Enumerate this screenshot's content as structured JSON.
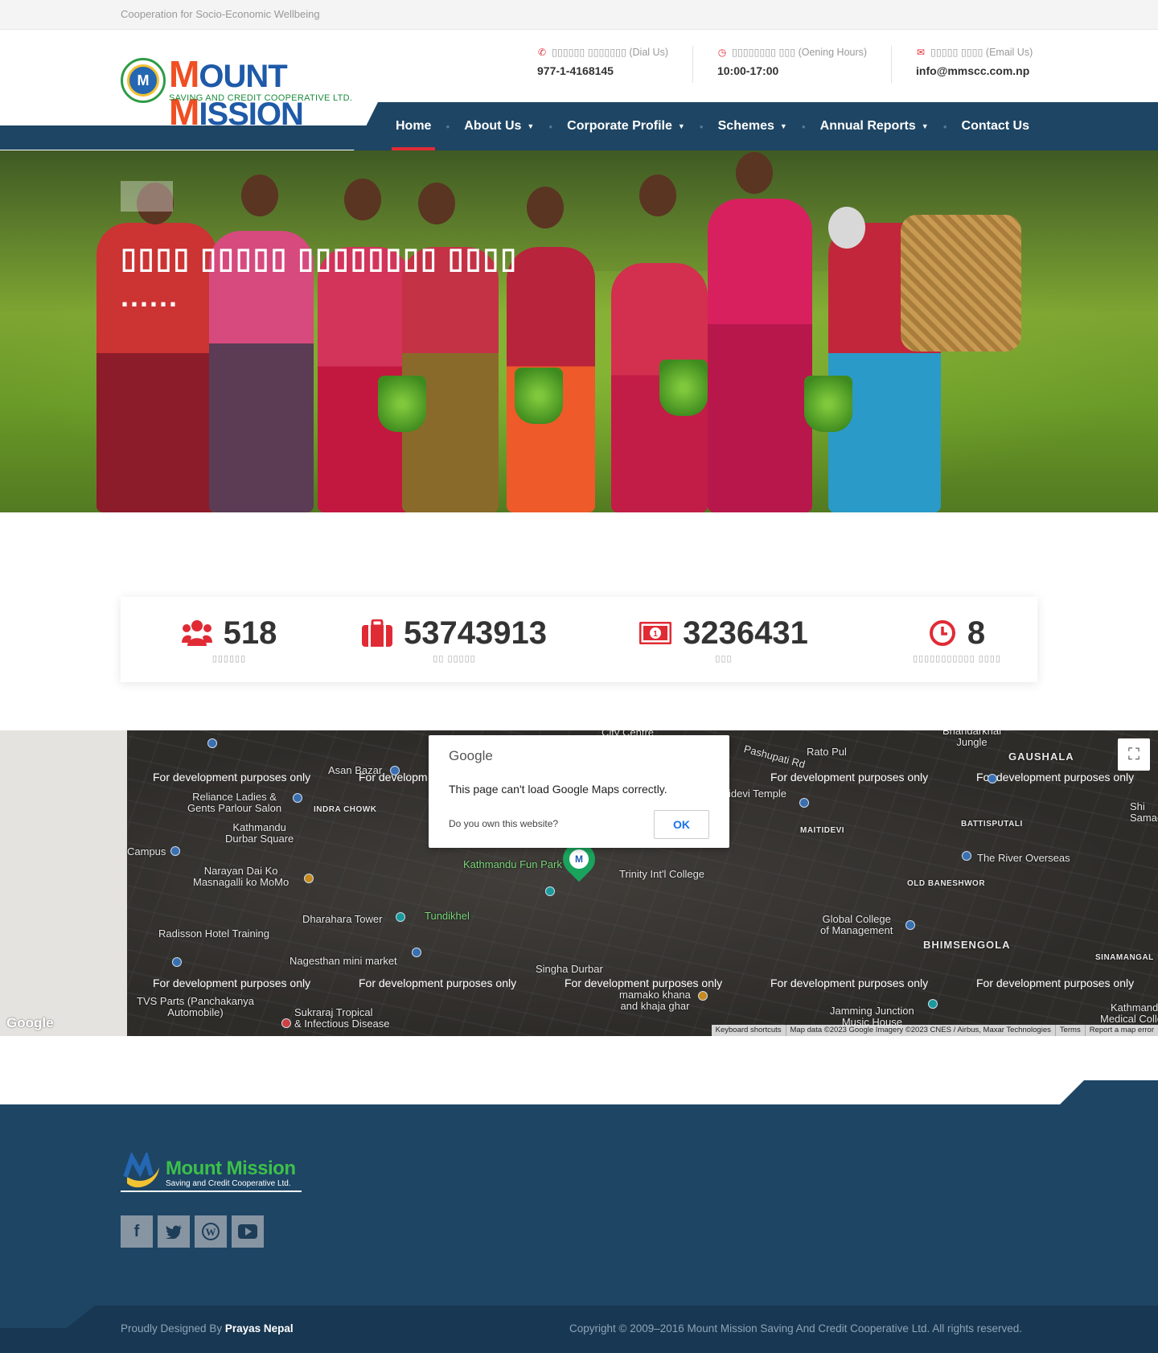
{
  "topbar": {
    "tagline": "Cooperation for Socio-Economic Wellbeing"
  },
  "logo": {
    "brand_first": "M",
    "brand_rest1": "OUNT ",
    "brand_second": "M",
    "brand_rest2": "ISSION",
    "subtitle": "SAVING AND CREDIT COOPERATIVE LTD."
  },
  "contacts": [
    {
      "icon": "phone-icon",
      "label": "▯▯▯▯▯▯ ▯▯▯▯▯▯▯ (Dial Us)",
      "value": "977-1-4168145"
    },
    {
      "icon": "clock-icon",
      "label": "▯▯▯▯▯▯▯▯ ▯▯▯ (Oening Hours)",
      "value": "10:00-17:00"
    },
    {
      "icon": "envelope-icon",
      "label": "▯▯▯▯▯ ▯▯▯▯ (Email Us)",
      "value": "info@mmscc.com.np"
    }
  ],
  "nav": {
    "home": "Home",
    "about": "About Us",
    "corporate": "Corporate Profile",
    "schemes": "Schemes",
    "annual": "Annual Reports",
    "contact": "Contact Us",
    "separator": "●"
  },
  "hero": {
    "headline": "▯▯▯▯ ▯▯▯▯▯ ▯▯▯▯▯▯▯▯ ▯▯▯▯ ......"
  },
  "stats": [
    {
      "icon": "users-icon",
      "value": "518",
      "label": "▯▯▯▯▯▯"
    },
    {
      "icon": "briefcase-icon",
      "value": "53743913",
      "label": "▯▯ ▯▯▯▯▯"
    },
    {
      "icon": "money-icon",
      "value": "3236431",
      "label": "▯▯▯"
    },
    {
      "icon": "clock-icon",
      "value": "8",
      "label": "▯▯▯▯▯▯▯▯▯▯▯ ▯▯▯▯"
    }
  ],
  "map": {
    "dev_text": "For development purposes only",
    "dialog": {
      "logo": "Google",
      "message": "This page can't load Google Maps correctly.",
      "own": "Do you own this website?",
      "ok": "OK"
    },
    "google_logo": "Google",
    "attribution": [
      "Keyboard shortcuts",
      "Map data ©2023 Google Imagery ©2023 CNES / Airbus, Maxar Technologies",
      "Terms",
      "Report a map error"
    ],
    "places": {
      "asan": "Asan Bazar",
      "reliance": "Reliance Ladies &\nGents Parlour Salon",
      "indra": "INDRA CHOWK",
      "durbar": "Kathmandu\nDurbar Square",
      "campus": "Campus",
      "narayan": "Narayan Dai Ko\nMasnagalli ko MoMo",
      "dharahara": "Dharahara Tower",
      "radisson": "Radisson Hotel Training",
      "nagesthan": "Nagesthan mini market",
      "tvs": "TVS Parts (Panchakanya\nAutomobile)",
      "sukraraj": "Sukraraj Tropical\n& Infectious Disease",
      "funpark": "Kathmandu Fun Park",
      "tundikhel": "Tundikhel",
      "trinity": "Trinity Int'l College",
      "singha": "Singha Durbar",
      "mamako": "mamako khana\nand khaja ghar",
      "pashupati": "Pashupati Rd",
      "ratopul": "Rato Pul",
      "bhandarkhal": "Bhandarkhal\nJungle",
      "gaushala": "GAUSHALA",
      "battisputali": "BATTISPUTALI",
      "maitidevi": "MAITIDEVI",
      "river": "The River Overseas",
      "baneshwor": "OLD BANESHWOR",
      "global": "Global College\nof Management",
      "bhimsengola": "BHIMSENGOLA",
      "sinamangal": "SINAMANGAL",
      "jamming": "Jamming Junction\nMusic House",
      "kmc": "Kathmandu\nMedical College",
      "temple": "idevi Temple",
      "shi": "Shi\nSamad",
      "city": "City Centre"
    }
  },
  "footer": {
    "logo_name": "Mount Mission",
    "logo_tag": "Saving and Credit Cooperative Ltd.",
    "social": [
      "facebook-icon",
      "twitter-icon",
      "wordpress-icon",
      "youtube-icon"
    ],
    "designed_prefix": "Proudly Designed By",
    "designer": "Prayas Nepal",
    "copyright": "Copyright © 2009–2016 Mount Mission Saving And Credit Cooperative Ltd. All rights reserved."
  },
  "colors": {
    "navy": "#1e4564",
    "accent_red": "#e02b35",
    "brand_orange": "#f04e23",
    "brand_blue": "#1e5aa8",
    "brand_green": "#1a8b3a"
  }
}
